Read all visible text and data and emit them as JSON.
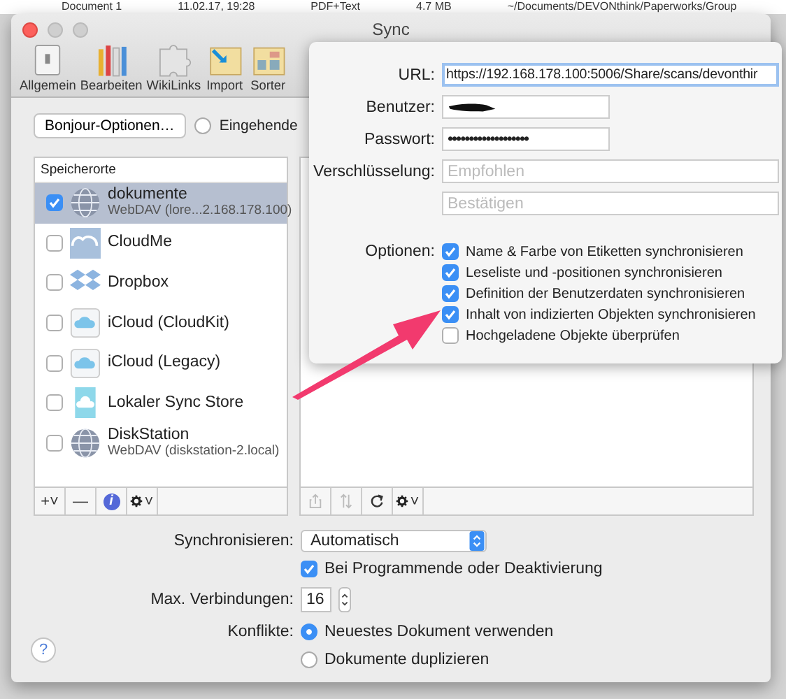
{
  "background_row": {
    "name": "Document 1",
    "date": "11.02.17, 19:28",
    "kind": "PDF+Text",
    "size": "4.7 MB",
    "path": "~/Documents/DEVONthink/Paperworks/Group"
  },
  "window": {
    "title": "Sync"
  },
  "toolbar": [
    {
      "label": "Allgemein"
    },
    {
      "label": "Bearbeiten"
    },
    {
      "label": "WikiLinks"
    },
    {
      "label": "Import"
    },
    {
      "label": "Sorter"
    }
  ],
  "bonjour_button": "Bonjour-Optionen…",
  "incoming_radio": {
    "label": "Eingehende",
    "selected": false
  },
  "locations": {
    "header": "Speicherorte",
    "items": [
      {
        "name": "dokumente",
        "subtitle": "WebDAV (lore...2.168.178.100)",
        "kind": "globe",
        "checked": true,
        "selected": true
      },
      {
        "name": "CloudMe",
        "kind": "cloudme",
        "checked": false,
        "selected": false
      },
      {
        "name": "Dropbox",
        "kind": "dropbox",
        "checked": false,
        "selected": false
      },
      {
        "name": "iCloud (CloudKit)",
        "kind": "icloud",
        "checked": false,
        "selected": false
      },
      {
        "name": "iCloud (Legacy)",
        "kind": "icloud",
        "checked": false,
        "selected": false
      },
      {
        "name": "Lokaler Sync Store",
        "kind": "local",
        "checked": false,
        "selected": false
      },
      {
        "name": "DiskStation",
        "subtitle": "WebDAV (diskstation-2.local)",
        "kind": "globe",
        "checked": false,
        "selected": false
      }
    ]
  },
  "left_bar": [
    {
      "kind": "add",
      "text": "+˅"
    },
    {
      "kind": "remove",
      "text": "—"
    },
    {
      "kind": "info",
      "text": "i"
    },
    {
      "kind": "gear",
      "text": "˅"
    }
  ],
  "right_bar": [
    {
      "kind": "share",
      "disabled": true
    },
    {
      "kind": "sort",
      "disabled": true
    },
    {
      "kind": "reload",
      "disabled": false
    },
    {
      "kind": "gear",
      "disabled": false,
      "text": "˅"
    }
  ],
  "settings": {
    "sync_label": "Synchronisieren:",
    "sync_value": "Automatisch",
    "quit_check": {
      "label": "Bei Programmende oder Deaktivierung",
      "checked": true
    },
    "max_label": "Max. Verbindungen:",
    "max_value": "16",
    "conflict_label": "Konflikte:",
    "conflicts": [
      {
        "label": "Neuestes Dokument verwenden",
        "selected": true
      },
      {
        "label": "Dokumente duplizieren",
        "selected": false
      }
    ]
  },
  "help_button": "?",
  "popover": {
    "url_label": "URL:",
    "url_value": "https://192.168.178.100:5006/Share/scans/devonthir",
    "user_label": "Benutzer:",
    "password_label": "Passwort:",
    "password_value": "•••••••••••••••••••",
    "encryption_label": "Verschlüsselung:",
    "encryption_placeholder": "Empfohlen",
    "confirm_placeholder": "Bestätigen",
    "options_label": "Optionen:",
    "options": [
      {
        "label": "Name & Farbe von Etiketten synchronisieren",
        "checked": true
      },
      {
        "label": "Leseliste und -positionen synchronisieren",
        "checked": true
      },
      {
        "label": "Definition der Benutzerdaten synchronisieren",
        "checked": true
      },
      {
        "label": "Inhalt von indizierten Objekten synchronisieren",
        "checked": true
      },
      {
        "label": "Hochgeladene Objekte überprüfen",
        "checked": false
      }
    ]
  }
}
